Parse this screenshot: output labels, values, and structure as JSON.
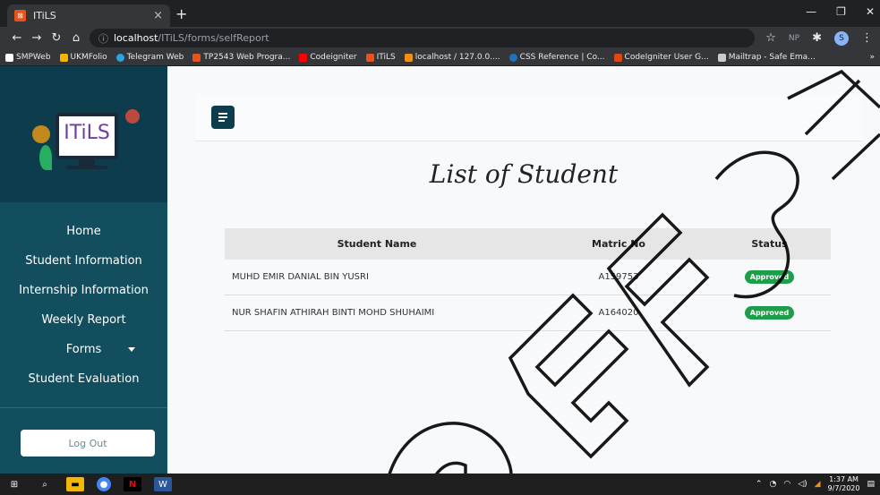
{
  "browser": {
    "tab_title": "ITiLS",
    "tab_close": "×",
    "new_tab": "+",
    "url_host": "localhost",
    "url_path": "/ITiLS/forms/selfReport",
    "bookmarks": [
      {
        "label": "SMPWeb",
        "color": "#ffffff"
      },
      {
        "label": "UKMFolio",
        "color": "#f2b705"
      },
      {
        "label": "Telegram Web",
        "color": "#2aa3e0"
      },
      {
        "label": "TP2543 Web Progra...",
        "color": "#e8521c"
      },
      {
        "label": "Codeigniter",
        "color": "#ff0000"
      },
      {
        "label": "ITiLS",
        "color": "#e8521c"
      },
      {
        "label": "localhost / 127.0.0....",
        "color": "#f29111"
      },
      {
        "label": "CSS Reference | Co...",
        "color": "#1e73be"
      },
      {
        "label": "CodeIgniter User G...",
        "color": "#dd4814"
      },
      {
        "label": "Mailtrap - Safe Ema...",
        "color": "#cccccc"
      }
    ],
    "profile_initial": "S"
  },
  "logo": {
    "text": "ITiLS"
  },
  "sidebar": {
    "items": [
      {
        "label": "Home"
      },
      {
        "label": "Student Information"
      },
      {
        "label": "Internship Information"
      },
      {
        "label": "Weekly Report"
      },
      {
        "label": "Forms"
      },
      {
        "label": "Student Evaluation"
      }
    ],
    "logout_label": "Log Out"
  },
  "page": {
    "title": "List of Student"
  },
  "table": {
    "headers": {
      "name": "Student Name",
      "matric": "Matric No",
      "status": "Status"
    },
    "rows": [
      {
        "name": "MUHD EMIR DANIAL BIN YUSRI",
        "matric": "A159753",
        "status": "Approved"
      },
      {
        "name": "NUR SHAFIN ATHIRAH BINTI MOHD SHUHAIMI",
        "matric": "A164020",
        "status": "Approved"
      }
    ]
  },
  "taskbar": {
    "time": "1:37 AM",
    "date": "9/7/2020"
  },
  "colors": {
    "sidebar": "#134e5e",
    "badge": "#1e9e4a",
    "accent": "#0d3d4d"
  }
}
